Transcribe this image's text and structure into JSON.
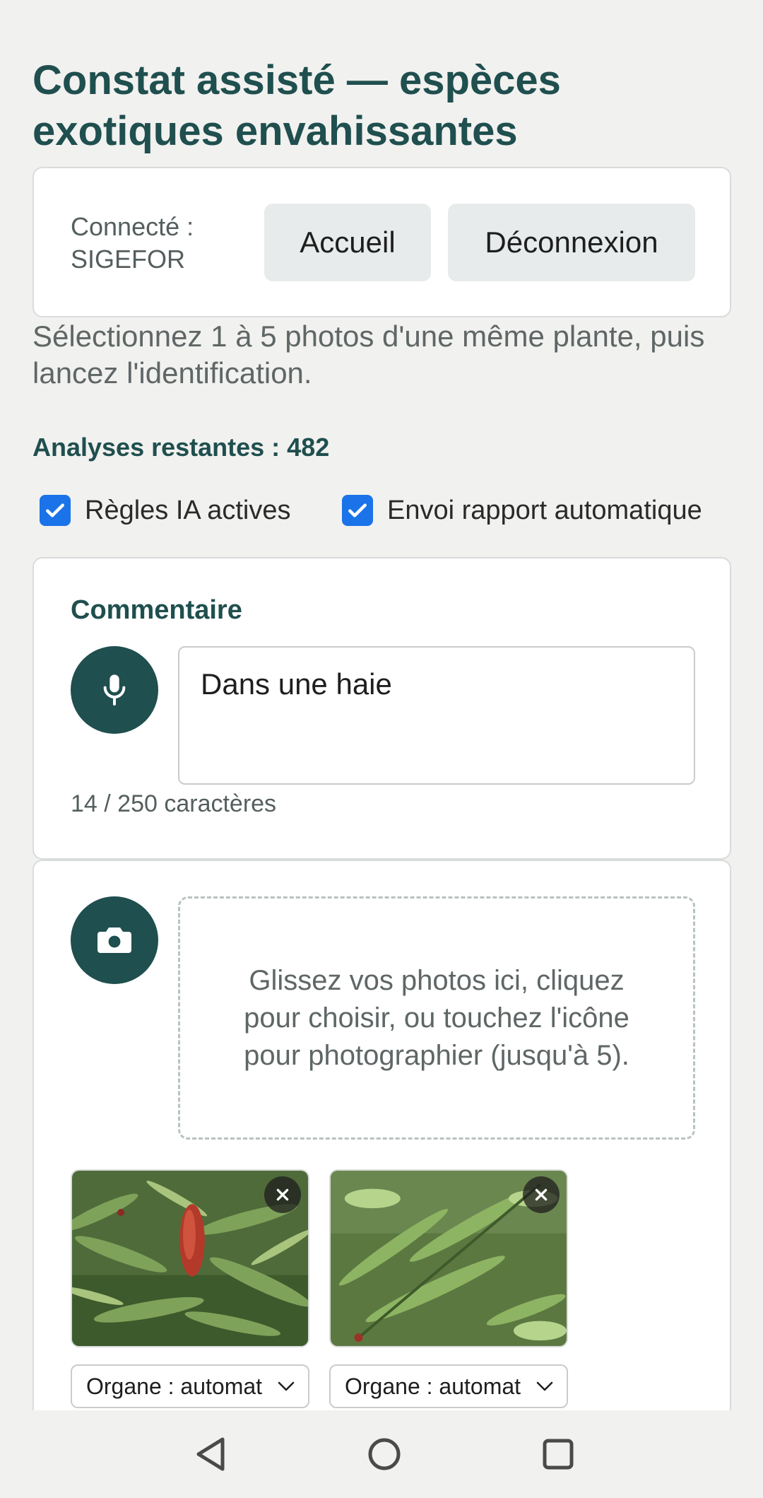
{
  "header": {
    "title": "Constat assisté — espèces exotiques envahissantes"
  },
  "user_card": {
    "connected_label": "Connecté : SIGEFOR",
    "home_button": "Accueil",
    "logout_button": "Déconnexion"
  },
  "intro_text": "Sélectionnez 1 à 5 photos d'une même plante, puis lancez l'identification.",
  "remaining_analyses": "Analyses restantes : 482",
  "options": [
    {
      "label": "Règles IA actives",
      "checked": true
    },
    {
      "label": "Envoi rapport automatique",
      "checked": true
    }
  ],
  "comment": {
    "title": "Commentaire",
    "value": "Dans une haie",
    "counter": "14 / 250 caractères",
    "icon": "microphone-icon"
  },
  "photos": {
    "icon": "camera-icon",
    "dropzone_text": "Glissez vos photos ici, cliquez pour choisir, ou touchez l'icône pour photographier (jusqu'à 5).",
    "items": [
      {
        "organ_select": "Organe : automat"
      },
      {
        "organ_select": "Organe : automat"
      }
    ]
  },
  "colors": {
    "accent": "#1f4f4e",
    "checkbox": "#1a73e8",
    "background": "#f1f1ef"
  }
}
